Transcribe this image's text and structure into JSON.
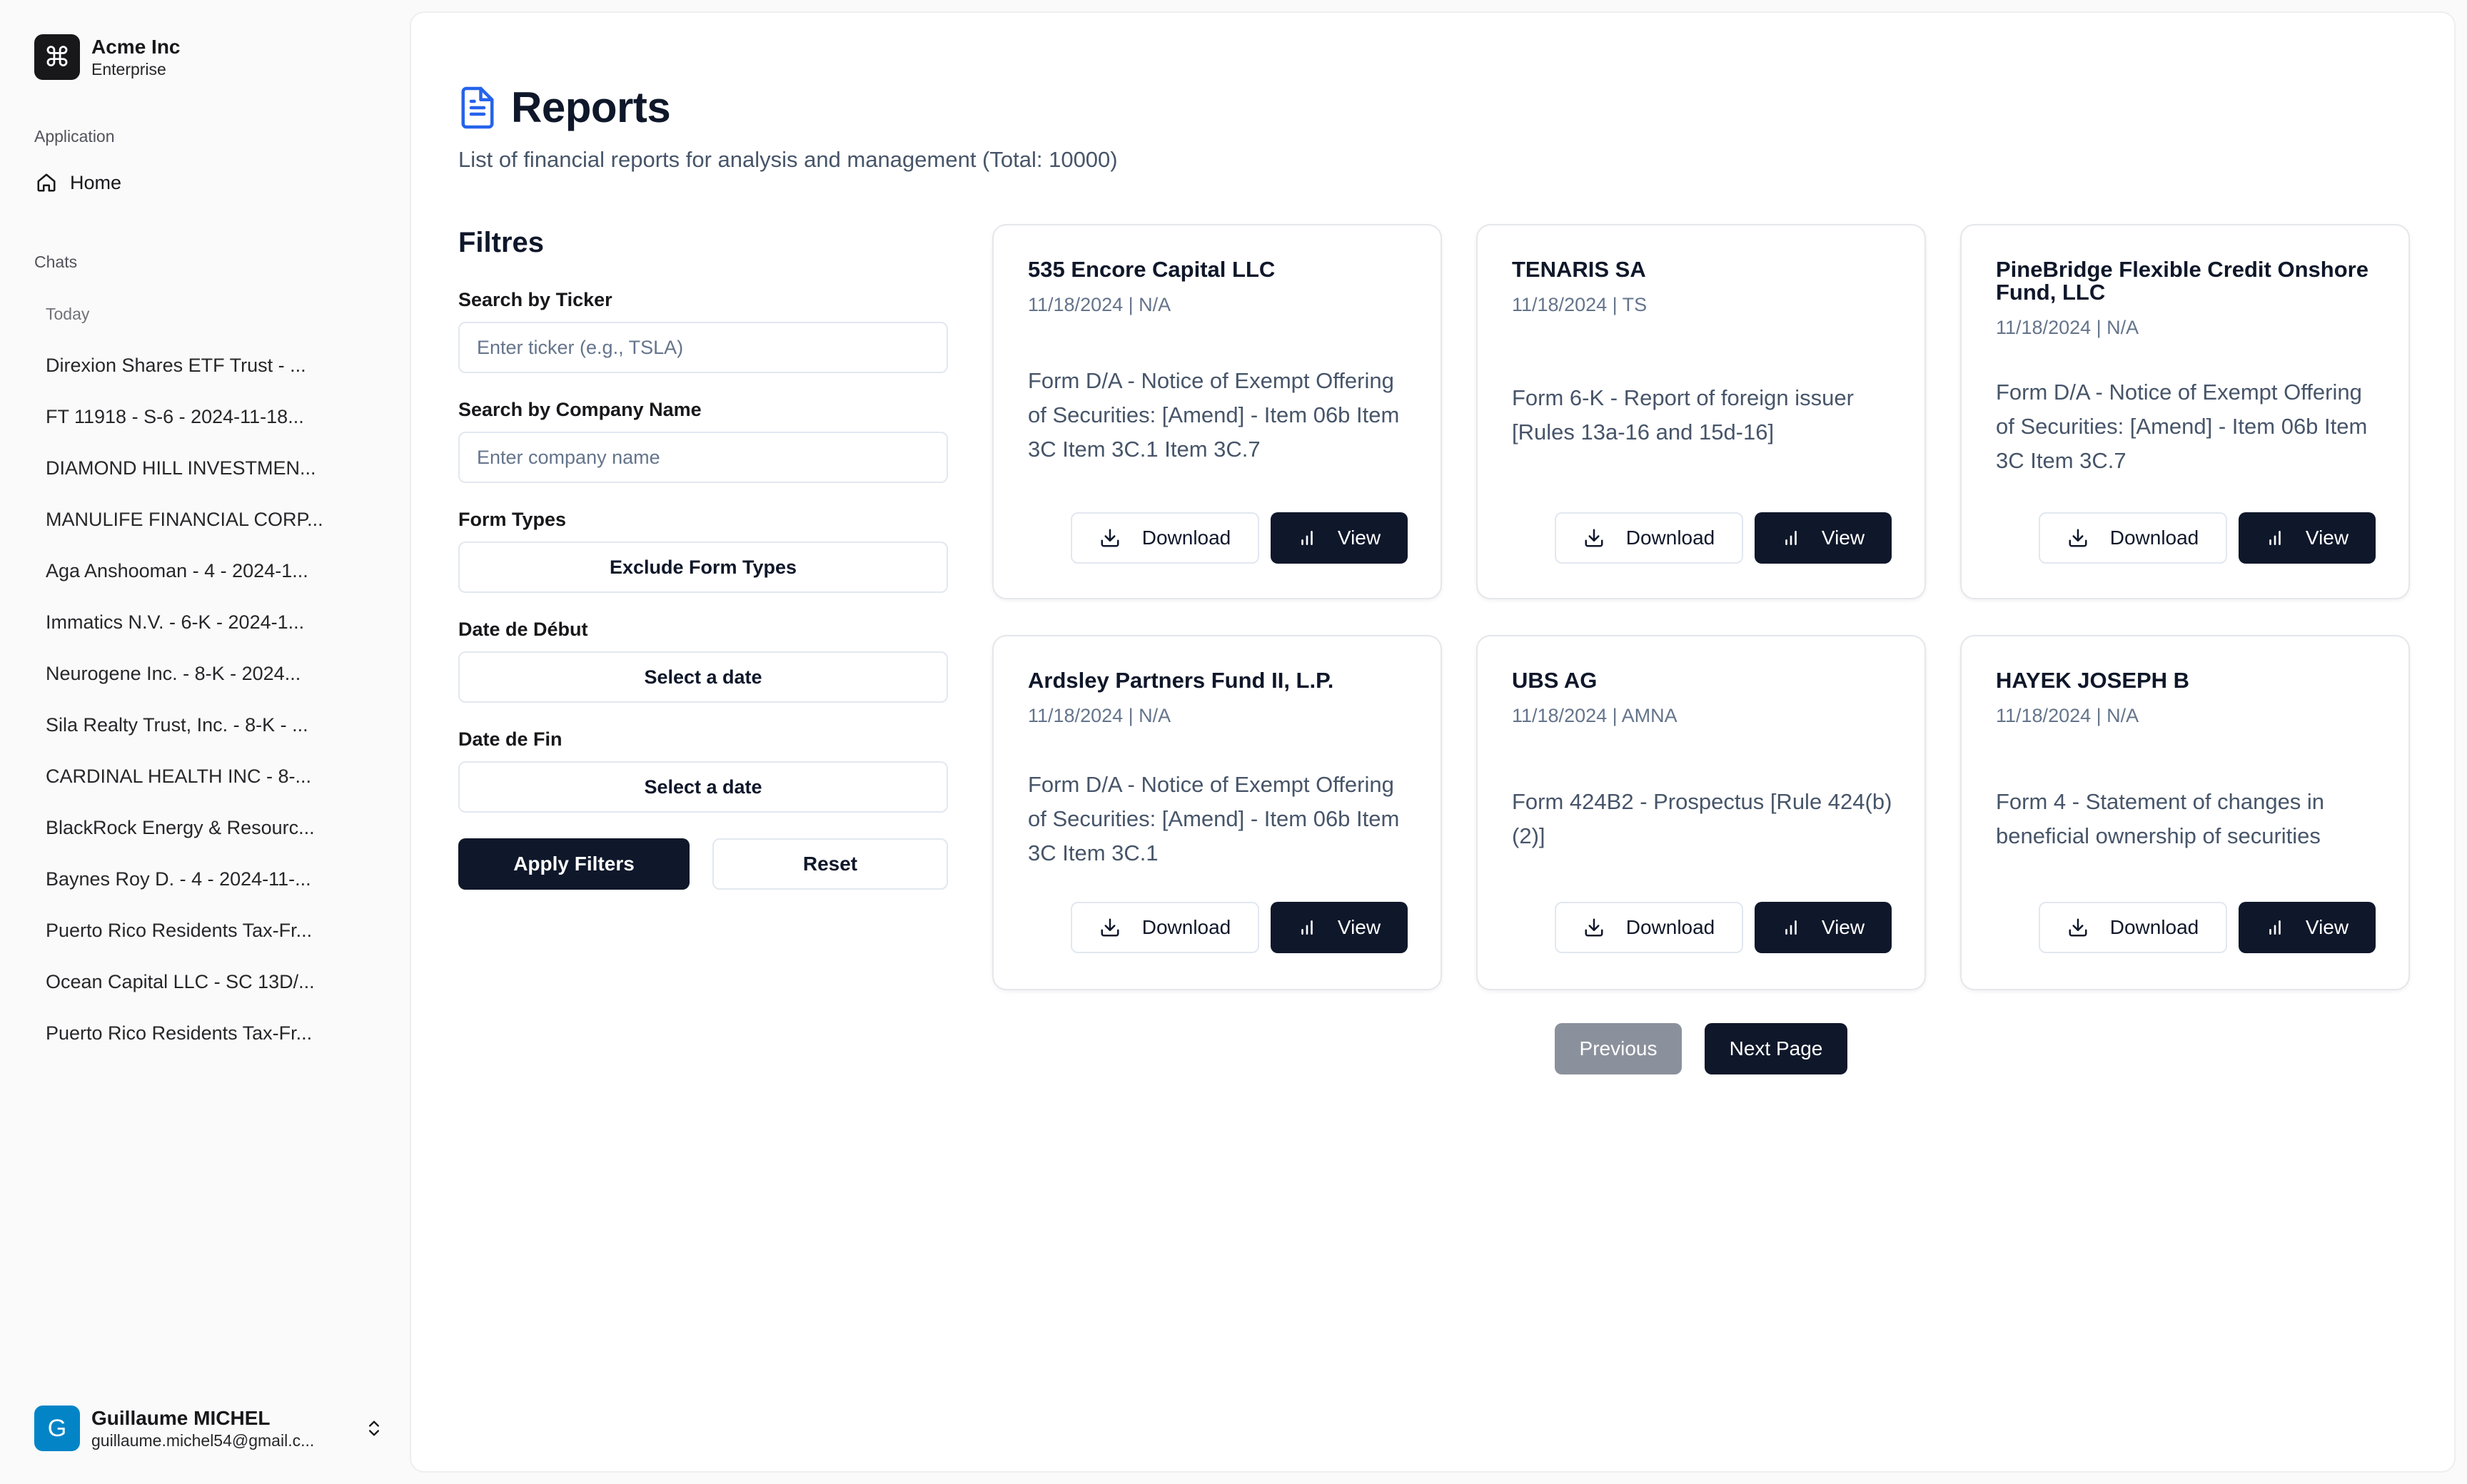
{
  "brand": {
    "name": "Acme Inc",
    "plan": "Enterprise",
    "logo_glyph": "⌘"
  },
  "sidebar": {
    "application_label": "Application",
    "home_label": "Home",
    "chats_label": "Chats",
    "today_label": "Today",
    "chats": [
      "Direxion Shares ETF Trust - ...",
      "FT 11918 - S-6 - 2024-11-18...",
      "DIAMOND HILL INVESTMEN...",
      "MANULIFE FINANCIAL CORP...",
      "Aga Anshooman - 4 - 2024-1...",
      "Immatics N.V. - 6-K - 2024-1...",
      "Neurogene Inc. - 8-K - 2024...",
      "Sila Realty Trust, Inc. - 8-K - ...",
      "CARDINAL HEALTH INC - 8-...",
      "BlackRock Energy & Resourc...",
      "Baynes Roy D. - 4 - 2024-11-...",
      "Puerto Rico Residents Tax-Fr...",
      "Ocean Capital LLC - SC 13D/...",
      "Puerto Rico Residents Tax-Fr..."
    ]
  },
  "user": {
    "initial": "G",
    "name": "Guillaume MICHEL",
    "email": "guillaume.michel54@gmail.c..."
  },
  "page": {
    "title": "Reports",
    "subtitle": "List of financial reports for analysis and management (Total: 10000)"
  },
  "filters": {
    "title": "Filtres",
    "ticker_label": "Search by Ticker",
    "ticker_placeholder": "Enter ticker (e.g., TSLA)",
    "company_label": "Search by Company Name",
    "company_placeholder": "Enter company name",
    "form_types_label": "Form Types",
    "form_types_button": "Exclude Form Types",
    "start_date_label": "Date de Début",
    "start_date_button": "Select a date",
    "end_date_label": "Date de Fin",
    "end_date_button": "Select a date",
    "apply_label": "Apply Filters",
    "reset_label": "Reset"
  },
  "cards": [
    {
      "name": "535 Encore Capital LLC",
      "meta": "11/18/2024 | N/A",
      "description": "Form D/A - Notice of Exempt Offering of Securities: [Amend] - Item 06b Item 3C Item 3C.1 Item 3C.7",
      "download": "Download",
      "view": "View"
    },
    {
      "name": "TENARIS SA",
      "meta": "11/18/2024 | TS",
      "description": "Form 6-K - Report of foreign issuer [Rules 13a-16 and 15d-16]",
      "download": "Download",
      "view": "View"
    },
    {
      "name": "PineBridge Flexible Credit Onshore Fund, LLC",
      "meta": "11/18/2024 | N/A",
      "description": "Form D/A - Notice of Exempt Offering of Securities: [Amend] - Item 06b Item 3C Item 3C.7",
      "download": "Download",
      "view": "View"
    },
    {
      "name": "Ardsley Partners Fund II, L.P.",
      "meta": "11/18/2024 | N/A",
      "description": "Form D/A - Notice of Exempt Offering of Securities: [Amend] - Item 06b Item 3C Item 3C.1",
      "download": "Download",
      "view": "View"
    },
    {
      "name": "UBS AG",
      "meta": "11/18/2024 | AMNA",
      "description": "Form 424B2 - Prospectus [Rule 424(b)(2)]",
      "download": "Download",
      "view": "View"
    },
    {
      "name": "HAYEK JOSEPH B",
      "meta": "11/18/2024 | N/A",
      "description": "Form 4 - Statement of changes in beneficial ownership of securities",
      "download": "Download",
      "view": "View"
    }
  ],
  "pagination": {
    "previous": "Previous",
    "next": "Next Page"
  },
  "colors": {
    "primary": "#0f172a",
    "accent": "#2563eb",
    "avatar": "#0284c7",
    "disabled": "#8b919c"
  }
}
